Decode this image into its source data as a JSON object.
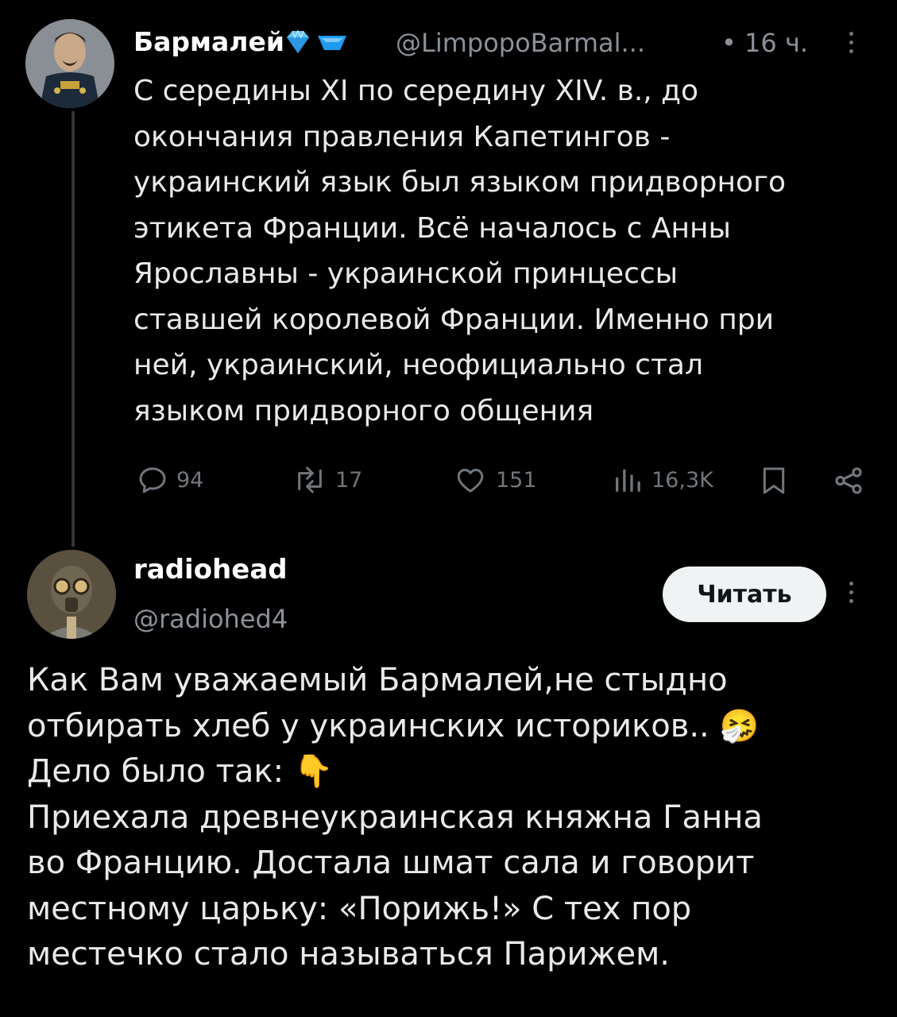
{
  "post": {
    "author_name": "Бармалей",
    "handle": "@LimpopoBarmal...",
    "time": "• 16 ч.",
    "text_lines": [
      "С середины XI по середину XIV. в., до",
      "окончания правления  Капетингов -",
      "украинский язык был языком придворного",
      "этикета Франции. Всё началось с Анны",
      "Ярославны - украинской принцессы",
      "ставшей королевой Франции. Именно при",
      "ней, украинский, неофициально стал",
      "языком придворного общения"
    ],
    "replies": "94",
    "reposts": "17",
    "likes": "151",
    "views": "16,3K"
  },
  "reply": {
    "author_name": "radiohead",
    "handle": "@radiohed4",
    "follow_label": "Читать",
    "line1": "Как Вам уважаемый Бармалей,не стыдно",
    "line2": "отбирать хлеб у украинских историков..",
    "line3": "Дело было так:",
    "line4": "Приехала древнеукраинская княжна Ганна",
    "line5": "во Францию. Достала шмат сала и говорит",
    "line6": "местному царьку: «Порижь!» С тех пор",
    "line7": "местечко стало называться Парижем.",
    "emoji1": "🤧",
    "emoji2": "👇"
  },
  "icons": [
    "verified-diamond-icon",
    "subscriber-badge-icon",
    "more-icon",
    "reply-icon",
    "repost-icon",
    "like-icon",
    "views-icon",
    "bookmark-icon",
    "share-icon"
  ]
}
